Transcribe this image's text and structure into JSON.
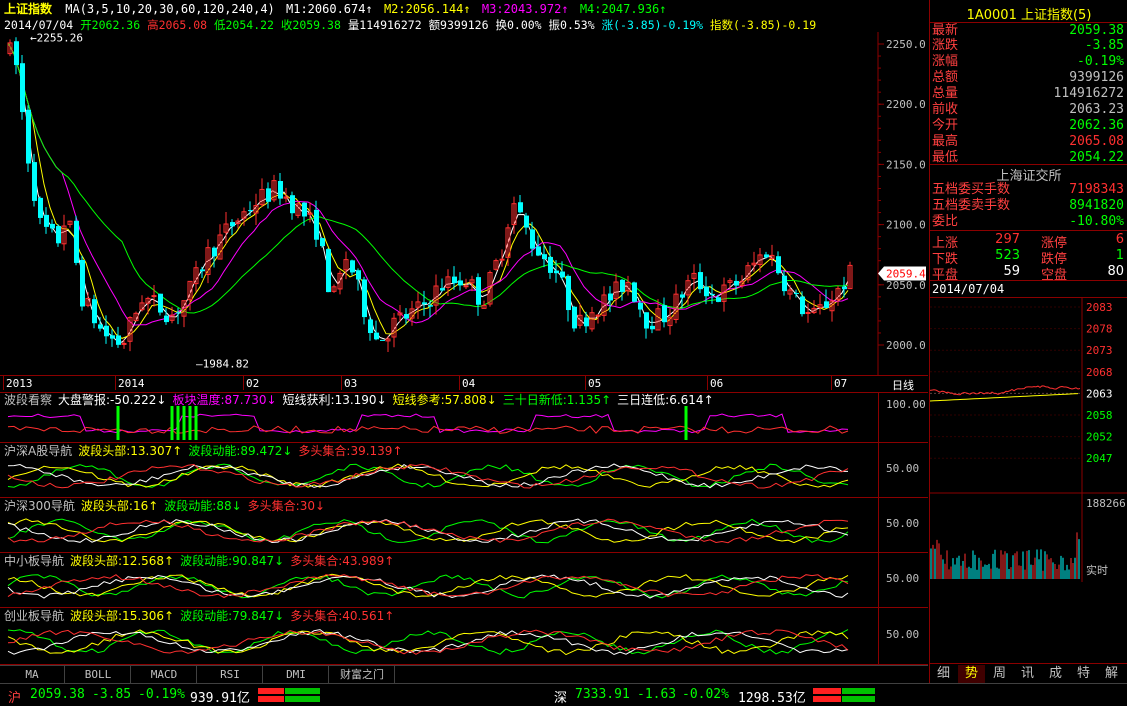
{
  "header": {
    "title": "上证指数",
    "ma_params": "MA(3,5,10,20,30,60,120,240,4)",
    "ma1": "M1:2060.674↑",
    "ma2": "M2:2056.144↑",
    "ma3": "M3:2043.972↑",
    "ma4": "M4:2047.936↑",
    "date": "2014/07/04",
    "open": "开2062.36",
    "high": "高2065.08",
    "low": "低2054.22",
    "close": "收2059.38",
    "volume": "量114916272",
    "amount": "额9399126",
    "turnover": "换0.00%",
    "amplitude": "振0.53%",
    "change": "涨(-3.85)-0.19%",
    "index_change": "指数(-3.85)-0.19"
  },
  "main_axis": {
    "ticks": [
      "2250.0",
      "2200.0",
      "2150.0",
      "2100.0",
      "2050.0",
      "2000.0"
    ],
    "current_price_tag": "2059.4",
    "high_mark": "2255.26",
    "low_mark": "1984.82"
  },
  "time_axis": {
    "labels": [
      "2013",
      "2014",
      "02",
      "03",
      "04",
      "05",
      "06",
      "07"
    ],
    "period": "日线"
  },
  "indicators": [
    {
      "title": "波段看察",
      "items": [
        {
          "text": "大盘警报:-50.222↓",
          "color": "#ffffff"
        },
        {
          "text": "板块温度:87.730↓",
          "color": "#ff00ff"
        },
        {
          "text": "短线获利:13.190↓",
          "color": "#ffffff"
        },
        {
          "text": "短线参考:57.808↓",
          "color": "#ffff00"
        },
        {
          "text": "三十日新低:1.135↑",
          "color": "#00ff00"
        },
        {
          "text": "三日连低:6.614↑",
          "color": "#ffffff"
        }
      ],
      "axis": "100.00"
    },
    {
      "title": "沪深A股导航",
      "items": [
        {
          "text": "波段头部:13.307↑",
          "color": "#ffff00"
        },
        {
          "text": "波段动能:89.472↓",
          "color": "#00ff00"
        },
        {
          "text": "多头集合:39.139↑",
          "color": "#ff3030"
        }
      ],
      "axis": "50.00"
    },
    {
      "title": "沪深300导航",
      "items": [
        {
          "text": "波段头部:16↑",
          "color": "#ffff00"
        },
        {
          "text": "波段动能:88↓",
          "color": "#00ff00"
        },
        {
          "text": "多头集合:30↓",
          "color": "#ff3030"
        }
      ],
      "axis": "50.00"
    },
    {
      "title": "中小板导航",
      "items": [
        {
          "text": "波段头部:12.568↑",
          "color": "#ffff00"
        },
        {
          "text": "波段动能:90.847↓",
          "color": "#00ff00"
        },
        {
          "text": "多头集合:43.989↑",
          "color": "#ff3030"
        }
      ],
      "axis": "50.00"
    },
    {
      "title": "创业板导航",
      "items": [
        {
          "text": "波段头部:15.306↑",
          "color": "#ffff00"
        },
        {
          "text": "波段动能:79.847↓",
          "color": "#00ff00"
        },
        {
          "text": "多头集合:40.561↑",
          "color": "#ff3030"
        }
      ],
      "axis": "50.00"
    }
  ],
  "bottom_tabs": [
    "MA",
    "BOLL",
    "MACD",
    "RSI",
    "DMI",
    "财富之门"
  ],
  "right_panel": {
    "code_title": "1A0001 上证指数(5)",
    "quotes": [
      {
        "k": "最新",
        "v": "2059.38",
        "c": "#00ff00"
      },
      {
        "k": "涨跌",
        "v": "-3.85",
        "c": "#00ff00"
      },
      {
        "k": "涨幅",
        "v": "-0.19%",
        "c": "#00ff00"
      },
      {
        "k": "总额",
        "v": "9399126",
        "c": "#c0c0c0"
      },
      {
        "k": "总量",
        "v": "114916272",
        "c": "#c0c0c0"
      },
      {
        "k": "前收",
        "v": "2063.23",
        "c": "#c0c0c0"
      },
      {
        "k": "今开",
        "v": "2062.36",
        "c": "#00ff00"
      },
      {
        "k": "最高",
        "v": "2065.08",
        "c": "#ff3030"
      },
      {
        "k": "最低",
        "v": "2054.22",
        "c": "#00ff00"
      }
    ],
    "exchange": "上海证交所",
    "book": [
      {
        "k": "五档委买手数",
        "v": "7198343",
        "c": "#ff3030"
      },
      {
        "k": "五档委卖手数",
        "v": "8941820",
        "c": "#00ff00"
      },
      {
        "k": "委比",
        "v": "-10.80%",
        "c": "#00ff00"
      }
    ],
    "breadth": {
      "up_label": "上涨",
      "up": "297",
      "limit_up_label": "涨停",
      "limit_up": "6",
      "down_label": "下跌",
      "down": "523",
      "limit_down_label": "跌停",
      "limit_down": "1",
      "flat_label": "平盘",
      "flat": "59",
      "empty_label": "空盘",
      "empty": "80"
    },
    "mini_date": "2014/07/04",
    "mini_ticks": [
      "2083",
      "2078",
      "2073",
      "2068",
      "2063",
      "2058",
      "2052",
      "2047"
    ],
    "vol_tick": "188266",
    "vol_label": "实时",
    "tabs": [
      "细",
      "势",
      "周",
      "讯",
      "成",
      "特",
      "解"
    ]
  },
  "status_bar": {
    "sh_label": "沪",
    "sh_price": "2059.38",
    "sh_change": "-3.85",
    "sh_pct": "-0.19%",
    "sh_amount": "939.91亿",
    "sz_label": "深",
    "sz_price": "7333.91",
    "sz_change": "-1.63",
    "sz_pct": "-0.02%",
    "sz_amount": "1298.53亿"
  },
  "colors": {
    "up": "#ff3030",
    "down": "#00ffff",
    "ma1": "#ffffff",
    "ma2": "#ffff00",
    "ma3": "#ff00ff",
    "ma4": "#00ff00",
    "border": "#8b0000"
  }
}
